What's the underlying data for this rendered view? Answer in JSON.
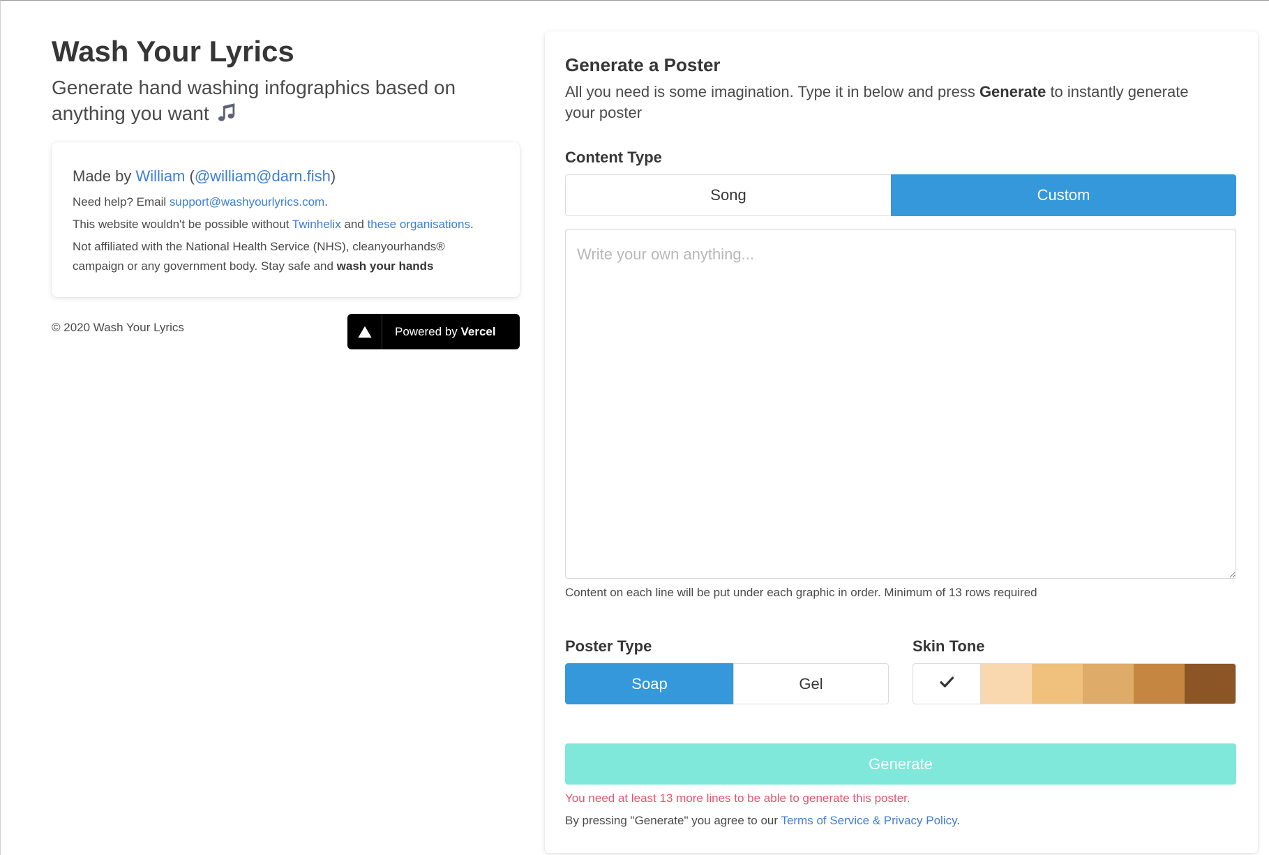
{
  "header": {
    "title": "Wash Your Lyrics",
    "subtitle": "Generate hand washing infographics based on anything you want",
    "subtitle_icon": "music-notes-icon"
  },
  "credits": {
    "made_by": "Made by ",
    "author_name": "William",
    "handle_open": " (",
    "handle": "@william@darn.fish",
    "handle_close": ")",
    "help_prefix": "Need help? Email ",
    "support_email": "support@washyourlyrics.com",
    "help_suffix": ".",
    "thanks_prefix": "This website wouldn't be possible without ",
    "thanks_link_1": "Twinhelix",
    "thanks_and": " and ",
    "thanks_link_2": "these organisations",
    "thanks_suffix": ".",
    "disclaimer": "Not affiliated with the National Health Service (NHS), cleanyourhands® campaign or any government body. Stay safe and ",
    "disclaimer_bold": "wash your hands"
  },
  "footer": {
    "copyright": "© 2020 Wash Your Lyrics",
    "badge_prefix": "Powered by ",
    "badge_brand": "Vercel",
    "badge_icon": "vercel-triangle-icon"
  },
  "generator": {
    "title": "Generate a Poster",
    "description_prefix": "All you need is some imagination. Type it in below and press ",
    "description_bold": "Generate",
    "description_suffix": " to instantly generate your poster",
    "content_type": {
      "label": "Content Type",
      "options": [
        {
          "label": "Song",
          "selected": false
        },
        {
          "label": "Custom",
          "selected": true
        }
      ]
    },
    "content": {
      "value": "",
      "placeholder": "Write your own anything...",
      "help": "Content on each line will be put under each graphic in order. Minimum of 13 rows required"
    },
    "poster_type": {
      "label": "Poster Type",
      "options": [
        {
          "label": "Soap",
          "selected": true
        },
        {
          "label": "Gel",
          "selected": false
        }
      ]
    },
    "skin_tone": {
      "label": "Skin Tone",
      "options": [
        {
          "color": "#ffffff",
          "icon": "check-icon",
          "selected": true
        },
        {
          "color": "#f9d8af",
          "selected": false
        },
        {
          "color": "#efc17d",
          "selected": false
        },
        {
          "color": "#dfab69",
          "selected": false
        },
        {
          "color": "#c58642",
          "selected": false
        },
        {
          "color": "#8c5526",
          "selected": false
        }
      ]
    },
    "generate_button": {
      "label": "Generate",
      "disabled": true
    },
    "error": "You need at least 13 more lines to be able to generate this poster.",
    "terms_prefix": "By pressing \"Generate\" you agree to our ",
    "terms_link": "Terms of Service & Privacy Policy",
    "terms_suffix": "."
  },
  "colors": {
    "accent": "#3498db",
    "generate_disabled": "#7fe8da",
    "error": "#e4546a",
    "link": "#3e7fd6"
  }
}
